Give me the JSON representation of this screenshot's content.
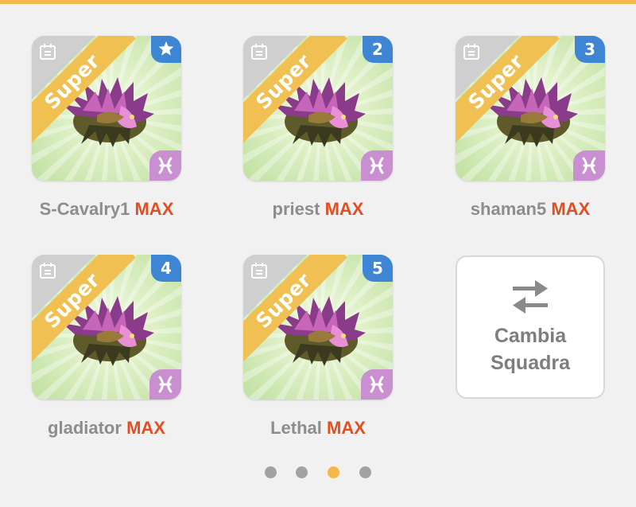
{
  "cards": [
    {
      "name": "S-Cavalry1",
      "level": "MAX",
      "ribbon": "Super",
      "badge": "star-icon",
      "badge_text": ""
    },
    {
      "name": "priest",
      "level": "MAX",
      "ribbon": "Super",
      "badge": "number",
      "badge_text": "2"
    },
    {
      "name": "shaman5",
      "level": "MAX",
      "ribbon": "Super",
      "badge": "number",
      "badge_text": "3"
    },
    {
      "name": "gladiator",
      "level": "MAX",
      "ribbon": "Super",
      "badge": "number",
      "badge_text": "4"
    },
    {
      "name": "Lethal",
      "level": "MAX",
      "ribbon": "Super",
      "badge": "number",
      "badge_text": "5"
    }
  ],
  "swap": {
    "line1": "Cambia",
    "line2": "Squadra",
    "icon": "swap-arrows-icon"
  },
  "pagination": {
    "total": 4,
    "active_index": 2
  },
  "colors": {
    "accent": "#f2b84a",
    "max_label": "#e24e22",
    "badge_blue": "#3e86d3",
    "ribbon_yellow": "#f0c152",
    "element_purple": "#c98fd0"
  }
}
